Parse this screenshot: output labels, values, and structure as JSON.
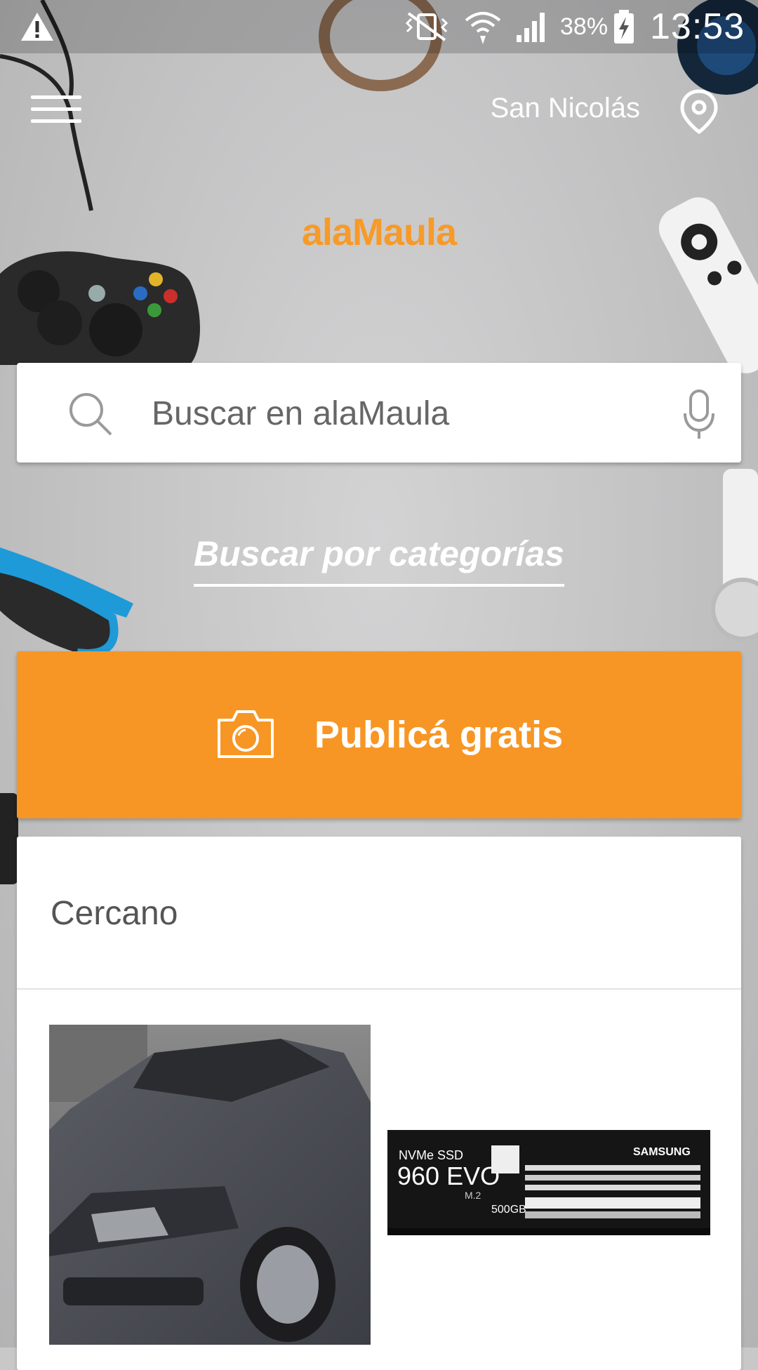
{
  "status_bar": {
    "battery": "38%",
    "time": "13:53"
  },
  "header": {
    "location": "San Nicolás"
  },
  "logo": {
    "text": "alaMaula"
  },
  "search": {
    "placeholder": "Buscar en alaMaula"
  },
  "categories": {
    "label": "Buscar por categorías"
  },
  "publish": {
    "label": "Publicá gratis"
  },
  "nearby": {
    "title": "Cercano",
    "ssd_image_text": {
      "line1": "NVMe SSD",
      "model": "960 EVO",
      "form": "M.2",
      "capacity": "500GB",
      "brand": "SAMSUNG"
    }
  },
  "colors": {
    "brand_orange": "#f79624",
    "logo_orange": "#f79a27"
  },
  "icons": [
    "warning-icon",
    "vibrate-icon",
    "wifi-icon",
    "signal-icon",
    "battery-icon",
    "menu-icon",
    "location-pin-icon",
    "search-icon",
    "mic-icon",
    "camera-icon"
  ]
}
